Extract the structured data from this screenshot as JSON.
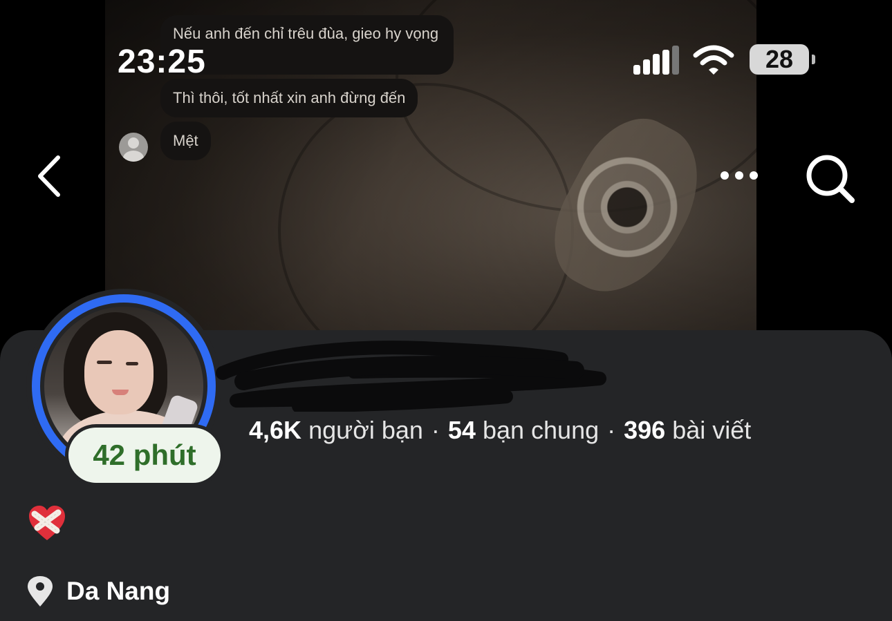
{
  "status_bar": {
    "time": "23:25",
    "battery": "28"
  },
  "cover": {
    "messages": [
      "Nếu anh đến chỉ trêu đùa, gieo hy vọng",
      "Thì thôi, tốt nhất xin anh đừng đến",
      "Mệt"
    ]
  },
  "nav": {
    "back_icon": "chevron-left-icon",
    "more_icon": "more-horizontal-icon",
    "search_icon": "search-icon"
  },
  "profile": {
    "active_badge": "42 phút",
    "stats": {
      "friends_count": "4,6K",
      "friends_label": "người bạn",
      "mutual_count": "54",
      "mutual_label": "bạn chung",
      "posts_count": "396",
      "posts_label": "bài viết",
      "separator": "·"
    },
    "bio_emoji": "mending-heart",
    "location_icon": "location-pin-icon",
    "location": "Da Nang"
  },
  "colors": {
    "panel_bg": "#242527",
    "story_ring": "#2f6bf3",
    "badge_bg": "#eef5ec",
    "badge_text": "#2f6e2a"
  }
}
